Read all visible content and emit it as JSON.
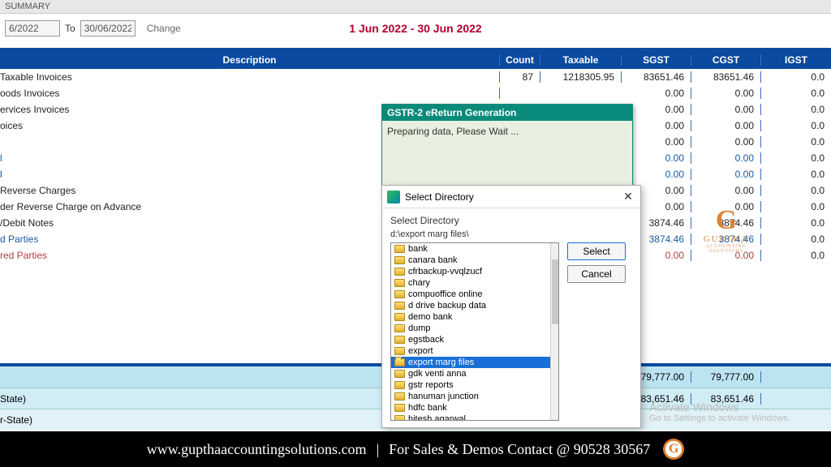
{
  "header": {
    "summary_label": "SUMMARY",
    "date_from": "6/2022",
    "to_label": "To",
    "date_to": "30/06/2022",
    "change_label": "Change",
    "date_range": "1 Jun 2022 - 30 Jun 2022"
  },
  "columns": {
    "desc": "Description",
    "count": "Count",
    "taxable": "Taxable",
    "sgst": "SGST",
    "cgst": "CGST",
    "igst": "IGST"
  },
  "rows": [
    {
      "desc": "Taxable Invoices",
      "count": "87",
      "taxable": "1218305.95",
      "sgst": "83651.46",
      "cgst": "83651.46",
      "igst": "0.0",
      "cls": ""
    },
    {
      "desc": "oods Invoices",
      "count": "",
      "taxable": "",
      "sgst": "0.00",
      "cgst": "0.00",
      "igst": "0.0",
      "cls": ""
    },
    {
      "desc": "ervices Invoices",
      "count": "",
      "taxable": "",
      "sgst": "0.00",
      "cgst": "0.00",
      "igst": "0.0",
      "cls": ""
    },
    {
      "desc": "oices",
      "count": "",
      "taxable": "",
      "sgst": "0.00",
      "cgst": "0.00",
      "igst": "0.0",
      "cls": ""
    },
    {
      "desc": "",
      "count": "",
      "taxable": "",
      "sgst": "0.00",
      "cgst": "0.00",
      "igst": "0.0",
      "cls": ""
    },
    {
      "desc": "l",
      "count": "",
      "taxable": "",
      "sgst": "0.00",
      "cgst": "0.00",
      "igst": "0.0",
      "cls": "linked"
    },
    {
      "desc": "l",
      "count": "",
      "taxable": "",
      "sgst": "0.00",
      "cgst": "0.00",
      "igst": "0.0",
      "cls": "linked"
    },
    {
      "desc": "Reverse Charges",
      "count": "",
      "taxable": "",
      "sgst": "0.00",
      "cgst": "0.00",
      "igst": "0.0",
      "cls": ""
    },
    {
      "desc": "der Reverse Charge on Advance",
      "count": "",
      "taxable": "",
      "sgst": "0.00",
      "cgst": "0.00",
      "igst": "0.0",
      "cls": ""
    },
    {
      "desc": "/Debit Notes",
      "count": "",
      "taxable": "",
      "sgst": "3874.46",
      "cgst": "3874.46",
      "igst": "0.0",
      "cls": ""
    },
    {
      "desc": "d Parties",
      "count": "",
      "taxable": "",
      "sgst": "3874.46",
      "cgst": "3874.46",
      "igst": "0.0",
      "cls": "linked"
    },
    {
      "desc": "red Parties",
      "count": "",
      "taxable": "",
      "sgst": "0.00",
      "cgst": "0.00",
      "igst": "0.0",
      "cls": "linked2"
    }
  ],
  "bottom": {
    "row1": {
      "desc": "",
      "sgst": "79,777.00",
      "cgst": "79,777.00",
      "igst": ""
    },
    "row2": {
      "desc": "State)",
      "sgst": "83,651.46",
      "cgst": "83,651.46",
      "igst": ""
    },
    "row3": {
      "desc": "r-State)"
    }
  },
  "ereturn": {
    "title": "GSTR-2 eReturn Generation",
    "body": "Preparing data, Please Wait ..."
  },
  "dir_dialog": {
    "title": "Select Directory",
    "label": "Select Directory",
    "path": "d:\\export marg files\\",
    "select_btn": "Select",
    "cancel_btn": "Cancel",
    "items": [
      {
        "name": "bank",
        "selected": false
      },
      {
        "name": "canara bank",
        "selected": false
      },
      {
        "name": "cfrbackup-vvqlzucf",
        "selected": false
      },
      {
        "name": "chary",
        "selected": false
      },
      {
        "name": "compuoffice online",
        "selected": false
      },
      {
        "name": "d drive backup data",
        "selected": false
      },
      {
        "name": "demo bank",
        "selected": false
      },
      {
        "name": "dump",
        "selected": false
      },
      {
        "name": "egstback",
        "selected": false
      },
      {
        "name": "export",
        "selected": false
      },
      {
        "name": "export marg files",
        "selected": true
      },
      {
        "name": "gdk venti anna",
        "selected": false
      },
      {
        "name": "gstr reports",
        "selected": false
      },
      {
        "name": "hanuman junction",
        "selected": false
      },
      {
        "name": "hdfc bank",
        "selected": false
      },
      {
        "name": "hitesh agarwal",
        "selected": false
      }
    ]
  },
  "watermark": {
    "line1": "Activate Windows",
    "line2": "Go to Settings to activate Windows."
  },
  "logo": {
    "g": "G",
    "txt": "GUPTHA",
    "sub": "ACCOUNTING SOLUTIONS"
  },
  "footer": {
    "url": "www.gupthaaccountingsolutions.com",
    "sep": "|",
    "text": "For Sales & Demos Contact @ 90528 30567"
  }
}
